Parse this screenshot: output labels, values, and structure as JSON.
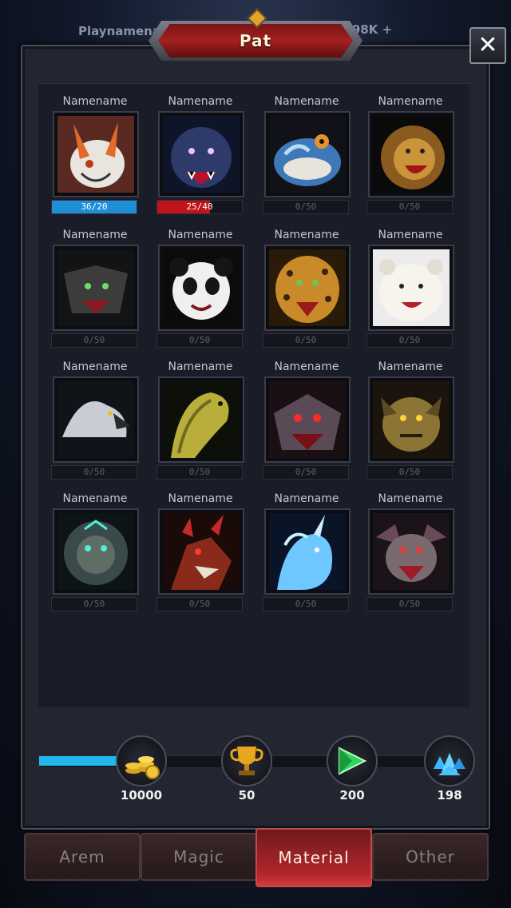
{
  "header": {
    "player_name": "Playnamename",
    "resource_value": "9098K",
    "resource_plus": "+",
    "title": "Pat",
    "close_glyph": "✕"
  },
  "pets": [
    {
      "name": "Namename",
      "progress_text": "36/20",
      "fill": 1.0,
      "fill_color": "#1e8fd6",
      "art": "white-fox"
    },
    {
      "name": "Namename",
      "progress_text": "25/40",
      "fill": 0.62,
      "fill_color": "#c0141a",
      "art": "blue-wolf"
    },
    {
      "name": "Namename",
      "progress_text": "0/50",
      "fill": 0,
      "fill_color": "",
      "art": "blue-frog"
    },
    {
      "name": "Namename",
      "progress_text": "0/50",
      "fill": 0,
      "fill_color": "",
      "art": "lion"
    },
    {
      "name": "Namename",
      "progress_text": "0/50",
      "fill": 0,
      "fill_color": "",
      "art": "dark-wolf"
    },
    {
      "name": "Namename",
      "progress_text": "0/50",
      "fill": 0,
      "fill_color": "",
      "art": "panda"
    },
    {
      "name": "Namename",
      "progress_text": "0/50",
      "fill": 0,
      "fill_color": "",
      "art": "jaguar"
    },
    {
      "name": "Namename",
      "progress_text": "0/50",
      "fill": 0,
      "fill_color": "",
      "art": "polar-bear"
    },
    {
      "name": "Namename",
      "progress_text": "0/50",
      "fill": 0,
      "fill_color": "",
      "art": "eagle"
    },
    {
      "name": "Namename",
      "progress_text": "0/50",
      "fill": 0,
      "fill_color": "",
      "art": "cobra"
    },
    {
      "name": "Namename",
      "progress_text": "0/50",
      "fill": 0,
      "fill_color": "",
      "art": "red-demon-wolf"
    },
    {
      "name": "Namename",
      "progress_text": "0/50",
      "fill": 0,
      "fill_color": "",
      "art": "goblin"
    },
    {
      "name": "Namename",
      "progress_text": "0/50",
      "fill": 0,
      "fill_color": "",
      "art": "spirit-lion"
    },
    {
      "name": "Namename",
      "progress_text": "0/50",
      "fill": 0,
      "fill_color": "",
      "art": "red-dragon"
    },
    {
      "name": "Namename",
      "progress_text": "0/50",
      "fill": 0,
      "fill_color": "",
      "art": "ice-unicorn"
    },
    {
      "name": "Namename",
      "progress_text": "0/50",
      "fill": 0,
      "fill_color": "",
      "art": "bat-beast"
    }
  ],
  "collection_progress": {
    "fill": 0.18
  },
  "rewards": [
    {
      "value": "10000",
      "icon": "gold-coins-icon"
    },
    {
      "value": "50",
      "icon": "trophy-icon"
    },
    {
      "value": "200",
      "icon": "green-gem-icon"
    },
    {
      "value": "198",
      "icon": "blue-crystals-icon"
    }
  ],
  "tabs": [
    {
      "label": "Arem",
      "active": false
    },
    {
      "label": "Magic",
      "active": false
    },
    {
      "label": "Material",
      "active": true
    },
    {
      "label": "Other",
      "active": false
    }
  ],
  "colors": {
    "accent_blue": "#1fb7ec",
    "tab_active": "#b3252c",
    "title_red": "#a42020"
  }
}
